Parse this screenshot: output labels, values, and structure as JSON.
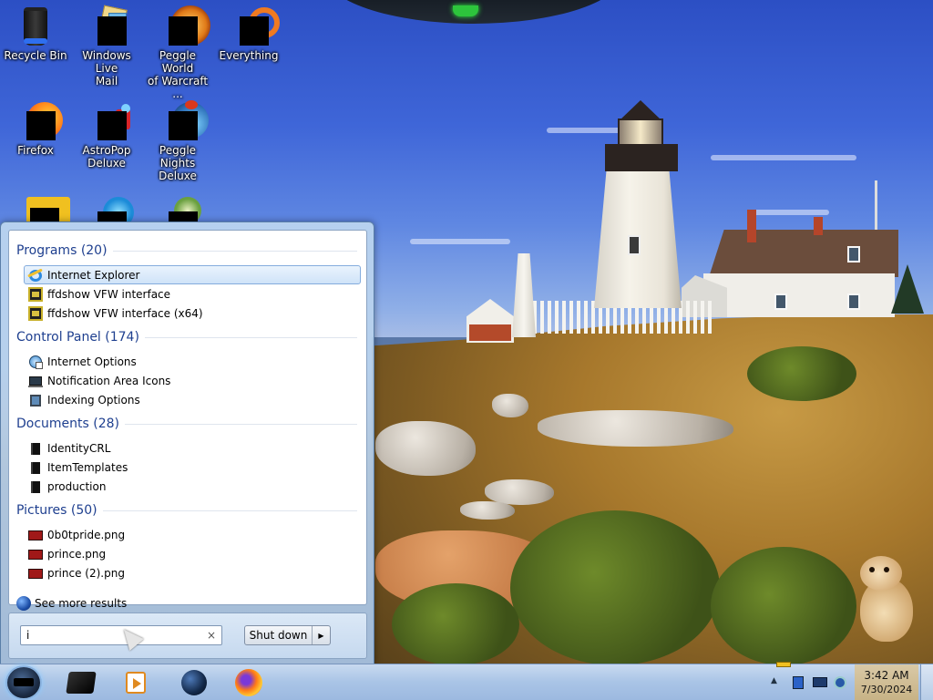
{
  "desktop": {
    "icons": [
      {
        "label": "Recycle Bin",
        "icon": "recycle-bin-icon"
      },
      {
        "label": "Windows Live\nMail",
        "icon": "windows-live-mail-icon"
      },
      {
        "label": "Peggle World\nof Warcraft ...",
        "icon": "peggle-wow-icon"
      },
      {
        "label": "Everything",
        "icon": "everything-search-icon"
      },
      {
        "label": "Firefox",
        "icon": "firefox-icon"
      },
      {
        "label": "AstroPop\nDeluxe",
        "icon": "astropop-icon"
      },
      {
        "label": "Peggle Nights\nDeluxe",
        "icon": "peggle-nights-icon"
      }
    ]
  },
  "start_menu": {
    "groups": [
      {
        "title": "Programs (20)",
        "items": [
          {
            "label": "Internet Explorer",
            "icon": "internet-explorer-icon",
            "selected": true
          },
          {
            "label": "ffdshow VFW interface",
            "icon": "ffdshow-icon"
          },
          {
            "label": "ffdshow VFW interface (x64)",
            "icon": "ffdshow-icon"
          }
        ]
      },
      {
        "title": "Control Panel (174)",
        "items": [
          {
            "label": "Internet Options",
            "icon": "internet-options-icon"
          },
          {
            "label": "Notification Area Icons",
            "icon": "notification-area-icon"
          },
          {
            "label": "Indexing Options",
            "icon": "indexing-options-icon"
          }
        ]
      },
      {
        "title": "Documents (28)",
        "items": [
          {
            "label": "IdentityCRL",
            "icon": "folder-icon"
          },
          {
            "label": "ItemTemplates",
            "icon": "folder-icon"
          },
          {
            "label": "production",
            "icon": "folder-icon"
          }
        ]
      },
      {
        "title": "Pictures (50)",
        "items": [
          {
            "label": "0b0tpride.png",
            "icon": "image-file-icon"
          },
          {
            "label": "prince.png",
            "icon": "image-file-icon"
          },
          {
            "label": "prince (2).png",
            "icon": "image-file-icon"
          }
        ]
      }
    ],
    "see_more": "See more results",
    "search": {
      "value": "i",
      "clear_glyph": "×"
    },
    "shutdown_label": "Shut down",
    "shutdown_arrow": "▶"
  },
  "taskbar": {
    "pinned": [
      "black-device-icon",
      "media-player-icon",
      "globe-browser-icon",
      "firefox-icon"
    ],
    "tray": {
      "expand_glyph": "▲"
    },
    "clock": {
      "time": "3:42 AM",
      "date": "7/30/2024"
    }
  },
  "colors": {
    "group_heading": "#1e3f8f",
    "selection_border": "#84acdd",
    "taskbar": "#a9c4e6"
  }
}
